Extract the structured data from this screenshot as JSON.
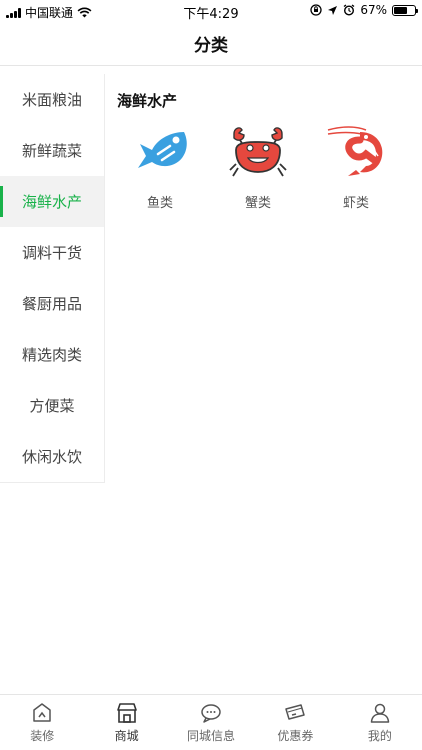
{
  "status_bar": {
    "carrier": "中国联通",
    "time": "下午4:29",
    "battery": "67%",
    "battery_level": 0.67
  },
  "nav": {
    "title": "分类"
  },
  "sidebar": {
    "items": [
      {
        "label": "米面粮油"
      },
      {
        "label": "新鲜蔬菜"
      },
      {
        "label": "海鲜水产",
        "active": true
      },
      {
        "label": "调料干货"
      },
      {
        "label": "餐厨用品"
      },
      {
        "label": "精选肉类"
      },
      {
        "label": "方便菜"
      },
      {
        "label": "休闲水饮"
      }
    ]
  },
  "content": {
    "section_title": "海鲜水产",
    "categories": [
      {
        "label": "鱼类",
        "icon": "fish-icon",
        "color": "#3aa0e0"
      },
      {
        "label": "蟹类",
        "icon": "crab-icon",
        "color": "#e5483e"
      },
      {
        "label": "虾类",
        "icon": "shrimp-icon",
        "color": "#e5483e"
      }
    ]
  },
  "tab_bar": {
    "items": [
      {
        "label": "装修",
        "icon": "home-icon"
      },
      {
        "label": "商城",
        "icon": "shop-icon",
        "active": true
      },
      {
        "label": "同城信息",
        "icon": "chat-icon"
      },
      {
        "label": "优惠券",
        "icon": "coupon-icon"
      },
      {
        "label": "我的",
        "icon": "user-icon"
      }
    ]
  },
  "colors": {
    "accent": "#19b24a"
  }
}
